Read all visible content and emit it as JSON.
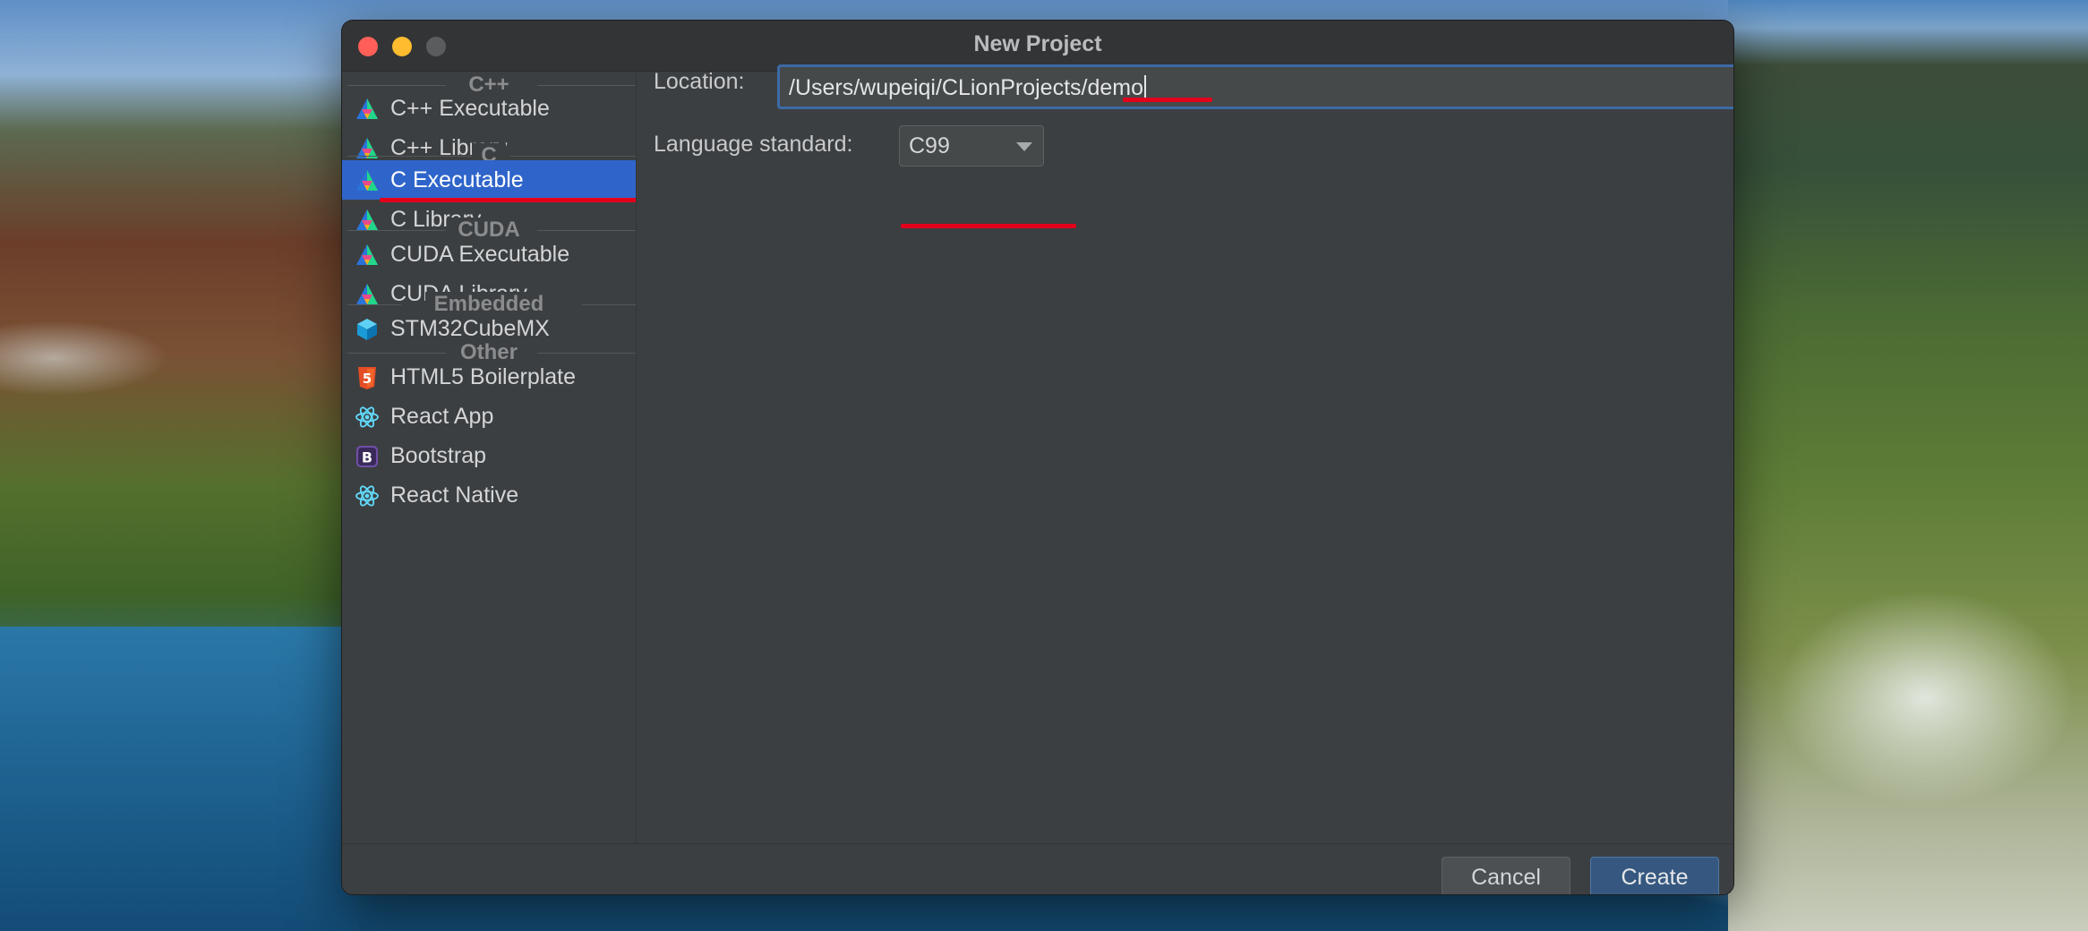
{
  "window": {
    "title": "New Project"
  },
  "sidebar": {
    "groups": [
      {
        "header": "C++",
        "items": [
          {
            "label": "C++ Executable",
            "icon": "clion-icon"
          },
          {
            "label": "C++ Library",
            "icon": "clion-icon"
          }
        ]
      },
      {
        "header": "C",
        "items": [
          {
            "label": "C Executable",
            "icon": "clion-icon",
            "selected": true
          },
          {
            "label": "C Library",
            "icon": "clion-icon"
          }
        ]
      },
      {
        "header": "CUDA",
        "items": [
          {
            "label": "CUDA Executable",
            "icon": "clion-icon"
          },
          {
            "label": "CUDA Library",
            "icon": "clion-icon"
          }
        ]
      },
      {
        "header": "Embedded",
        "items": [
          {
            "label": "STM32CubeMX",
            "icon": "cube-icon"
          }
        ]
      },
      {
        "header": "Other",
        "items": [
          {
            "label": "HTML5 Boilerplate",
            "icon": "html5-icon"
          },
          {
            "label": "React App",
            "icon": "react-icon"
          },
          {
            "label": "Bootstrap",
            "icon": "bootstrap-icon"
          },
          {
            "label": "React Native",
            "icon": "react-icon"
          }
        ]
      }
    ]
  },
  "form": {
    "location_label": "Location:",
    "location_value": "/Users/wupeiqi/CLionProjects/demo",
    "language_label": "Language standard:",
    "language_value": "C99"
  },
  "footer": {
    "cancel_label": "Cancel",
    "create_label": "Create"
  },
  "colors": {
    "selection": "#2f65ca",
    "annotation_underline": "#e3001b",
    "create_button": "#365880"
  }
}
